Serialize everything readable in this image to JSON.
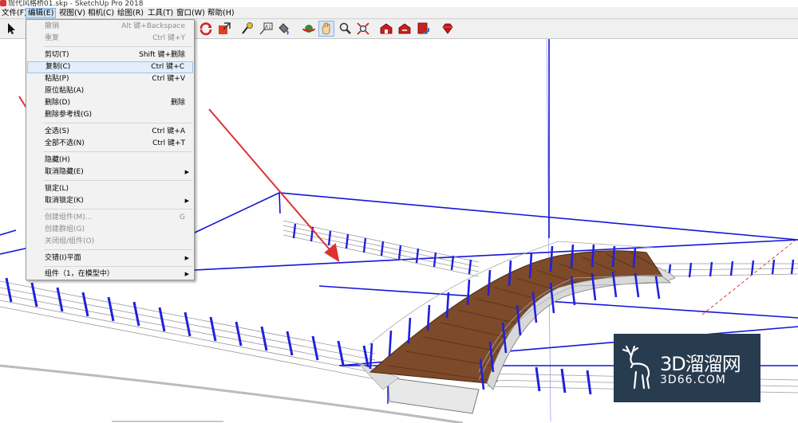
{
  "window": {
    "title": "现代风格桥01.skp - SketchUp Pro 2018"
  },
  "menubar": [
    {
      "label": "文件(F)"
    },
    {
      "label": "编辑(E)"
    },
    {
      "label": "视图(V)"
    },
    {
      "label": "相机(C)"
    },
    {
      "label": "绘图(R)"
    },
    {
      "label": "工具(T)"
    },
    {
      "label": "窗口(W)"
    },
    {
      "label": "帮助(H)"
    }
  ],
  "edit_menu": {
    "items": [
      {
        "label": "撤销",
        "shortcut": "Alt 键+Backspace"
      },
      {
        "label": "重复",
        "shortcut": "Ctrl 键+Y"
      },
      {
        "label": "剪切(T)",
        "shortcut": "Shift 键+删除"
      },
      {
        "label": "复制(C)",
        "shortcut": "Ctrl 键+C"
      },
      {
        "label": "粘贴(P)",
        "shortcut": "Ctrl 键+V"
      },
      {
        "label": "原位粘贴(A)",
        "shortcut": ""
      },
      {
        "label": "删除(D)",
        "shortcut": "删除"
      },
      {
        "label": "删除参考线(G)",
        "shortcut": ""
      },
      {
        "label": "全选(S)",
        "shortcut": "Ctrl 键+A"
      },
      {
        "label": "全部不选(N)",
        "shortcut": "Ctrl 键+T"
      },
      {
        "label": "隐藏(H)",
        "shortcut": ""
      },
      {
        "label": "取消隐藏(E)",
        "shortcut": ""
      },
      {
        "label": "锁定(L)",
        "shortcut": ""
      },
      {
        "label": "取消锁定(K)",
        "shortcut": ""
      },
      {
        "label": "创建组件(M)...",
        "shortcut": "G"
      },
      {
        "label": "创建群组(G)",
        "shortcut": ""
      },
      {
        "label": "关闭组/组件(O)",
        "shortcut": ""
      },
      {
        "label": "交错(I)平面",
        "shortcut": ""
      },
      {
        "label": "组件（1，在模型中）",
        "shortcut": ""
      }
    ]
  },
  "watermark": {
    "brand": "3D溜溜网",
    "url": "3D66.COM"
  }
}
